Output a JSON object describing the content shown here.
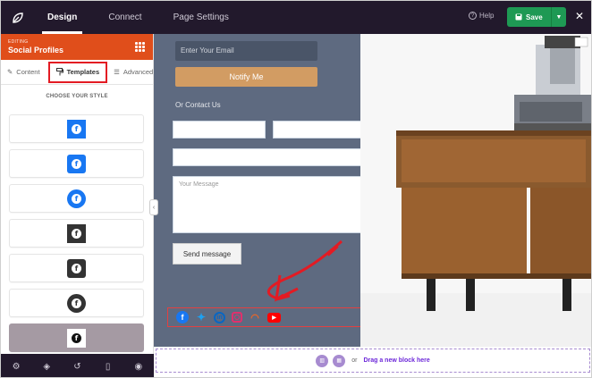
{
  "topbar": {
    "tabs": [
      {
        "label": "Design",
        "active": true
      },
      {
        "label": "Connect",
        "active": false
      },
      {
        "label": "Page Settings",
        "active": false
      }
    ],
    "help_label": "Help",
    "save_label": "Save"
  },
  "panel": {
    "editing_label": "EDITING",
    "title": "Social Profiles",
    "tabs": [
      {
        "label": "Content",
        "icon": "pencil-icon"
      },
      {
        "label": "Templates",
        "icon": "paint-roller-icon",
        "active": true
      },
      {
        "label": "Advanced",
        "icon": "sliders-icon"
      }
    ],
    "choose_label": "CHOOSE YOUR STYLE",
    "styles": [
      {
        "name": "blue-square"
      },
      {
        "name": "blue-rounded"
      },
      {
        "name": "blue-circle"
      },
      {
        "name": "dark-square"
      },
      {
        "name": "dark-rounded"
      },
      {
        "name": "dark-circle"
      },
      {
        "name": "white-on-gray",
        "selected": true
      }
    ],
    "bottom_icons": [
      "gear-icon",
      "layers-icon",
      "history-icon",
      "mobile-icon",
      "eye-icon"
    ]
  },
  "canvas": {
    "email_placeholder": "Enter Your Email",
    "notify_label": "Notify Me",
    "contact_label": "Or Contact Us",
    "message_placeholder": "Your Message",
    "send_label": "Send message",
    "social_icons": [
      "facebook-icon",
      "twitter-icon",
      "linkedin-icon",
      "instagram-icon",
      "rss-icon",
      "youtube-icon"
    ],
    "drop_or": "or",
    "drop_link": "Drag a new block here"
  },
  "colors": {
    "accent_orange": "#e04e1b",
    "save_green": "#1e9954",
    "topbar": "#22192c",
    "form_bg": "#5e6a80",
    "annotation_red": "#e31b23"
  }
}
